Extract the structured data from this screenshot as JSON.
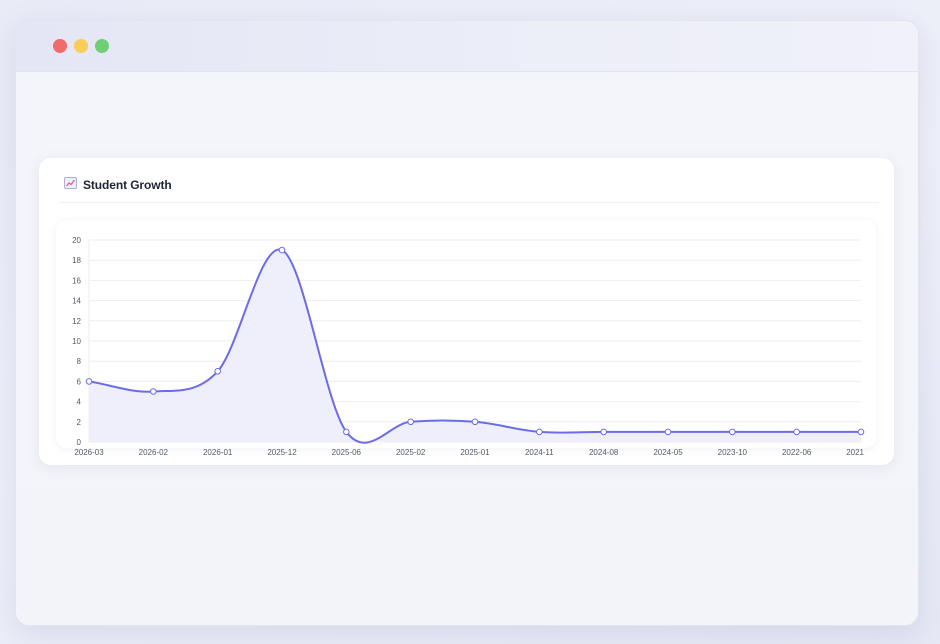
{
  "card": {
    "title": "Student Growth",
    "icon": "chart-increasing-icon"
  },
  "colors": {
    "line": "#6b6ce6",
    "fill": "#ececfb",
    "grid": "#eceef3",
    "point_fill": "#ffffff"
  },
  "chart_data": {
    "type": "line",
    "title": "",
    "xlabel": "",
    "ylabel": "",
    "categories": [
      "2026-03",
      "2026-02",
      "2026-01",
      "2025-12",
      "2025-06",
      "2025-02",
      "2025-01",
      "2024-11",
      "2024-08",
      "2024-05",
      "2023-10",
      "2022-06",
      "2021"
    ],
    "series": [
      {
        "values": [
          6,
          5,
          7,
          19,
          1,
          2,
          2,
          1,
          1,
          1,
          1,
          1,
          1
        ]
      }
    ],
    "ylim": [
      0,
      20
    ],
    "yticks": [
      0,
      2,
      4,
      6,
      8,
      10,
      12,
      14,
      16,
      18,
      20
    ],
    "grid": true,
    "legend": "none",
    "smooth": true,
    "area": true
  }
}
